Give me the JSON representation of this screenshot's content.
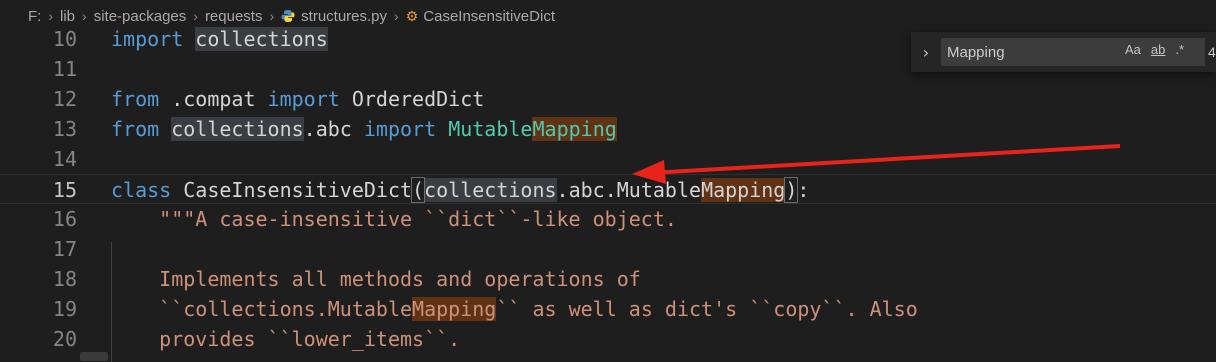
{
  "breadcrumb": [
    "F:",
    "lib",
    "site-packages",
    "requests",
    "structures.py",
    "CaseInsensitiveDict"
  ],
  "find": {
    "value": "Mapping",
    "toggle": "›",
    "case_opt": "Aa",
    "word_opt": "ab",
    "regex_opt": ".*",
    "result_count": "4"
  },
  "lines": [
    {
      "number": "10",
      "tokens": [
        {
          "t": "import",
          "c": "kw"
        },
        {
          "t": " ",
          "c": "plain"
        },
        {
          "t": "collections",
          "c": "plain",
          "h": "hl-sel"
        }
      ]
    },
    {
      "number": "11",
      "tokens": []
    },
    {
      "number": "12",
      "tokens": [
        {
          "t": "from",
          "c": "kw"
        },
        {
          "t": " .compat ",
          "c": "plain"
        },
        {
          "t": "import",
          "c": "kw"
        },
        {
          "t": " ",
          "c": "plain"
        },
        {
          "t": "OrderedDict",
          "c": "plain"
        }
      ]
    },
    {
      "number": "13",
      "tokens": [
        {
          "t": "from",
          "c": "kw"
        },
        {
          "t": " ",
          "c": "plain"
        },
        {
          "t": "collections",
          "c": "plain",
          "h": "hl-sel"
        },
        {
          "t": ".abc ",
          "c": "plain"
        },
        {
          "t": "import",
          "c": "kw"
        },
        {
          "t": " ",
          "c": "plain"
        },
        {
          "t": "Mutable",
          "c": "cls"
        },
        {
          "t": "Mapping",
          "c": "cls",
          "h": "hl-find"
        }
      ]
    },
    {
      "number": "14",
      "tokens": []
    },
    {
      "number": "15",
      "tokens": [
        {
          "t": "class",
          "c": "kw"
        },
        {
          "t": " ",
          "c": "plain"
        },
        {
          "t": "CaseInsensitiveDict",
          "c": "plain"
        },
        {
          "t": "(",
          "c": "plain",
          "h": "hl-box"
        },
        {
          "t": "collections",
          "c": "plain",
          "h": "hl-sel"
        },
        {
          "t": ".abc.",
          "c": "plain"
        },
        {
          "t": "Mutable",
          "c": "plain"
        },
        {
          "t": "Mapping",
          "c": "plain",
          "h": "hl-find"
        },
        {
          "t": ")",
          "c": "plain",
          "h": "hl-box"
        },
        {
          "t": ":",
          "c": "plain"
        }
      ]
    },
    {
      "number": "16",
      "tokens": [
        {
          "t": "    \"\"\"A case-insensitive ``dict``-like object.",
          "c": "str"
        }
      ]
    },
    {
      "number": "17",
      "tokens": []
    },
    {
      "number": "18",
      "tokens": [
        {
          "t": "    Implements all methods and operations of",
          "c": "str"
        }
      ]
    },
    {
      "number": "19",
      "tokens": [
        {
          "t": "    ``collections.Mutable",
          "c": "str"
        },
        {
          "t": "Mapping",
          "c": "str",
          "h": "hl-find"
        },
        {
          "t": "`` as well as dict's ``copy``. Also",
          "c": "str"
        }
      ]
    },
    {
      "number": "20",
      "tokens": [
        {
          "t": "    provides ``lower_items``.",
          "c": "str"
        }
      ]
    }
  ],
  "current_line": "15",
  "colors": {
    "keyword": "#569cd6",
    "string": "#ce9178",
    "find_match": "#613214",
    "arrow": "#e8231a"
  }
}
